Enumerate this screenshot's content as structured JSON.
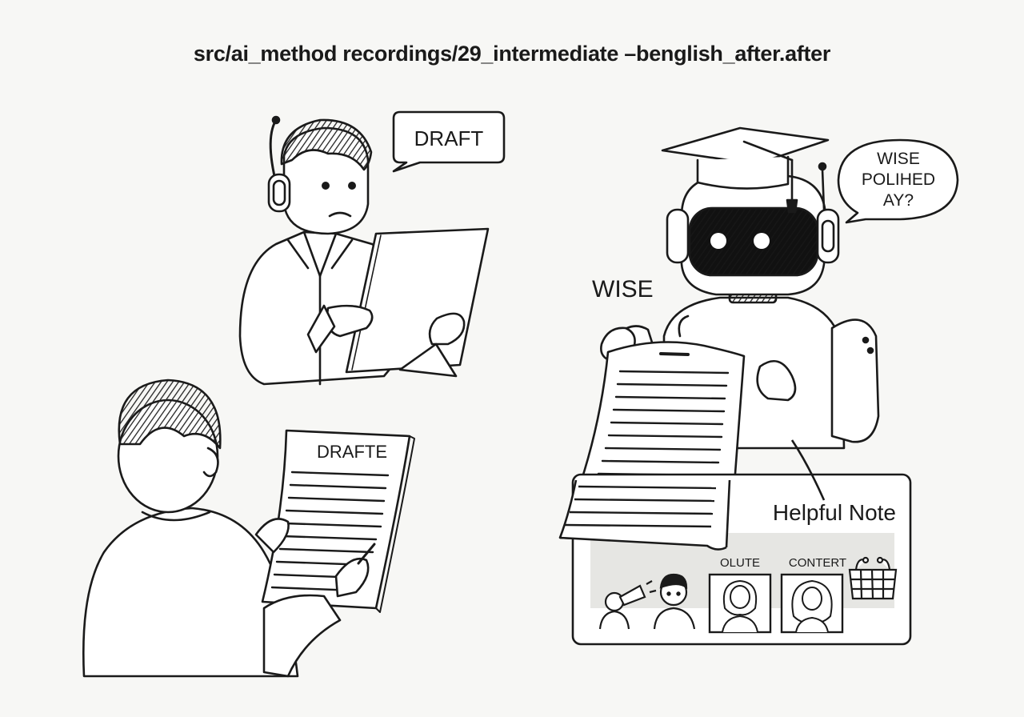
{
  "header": {
    "title": "src/ai_method recordings/29_intermediate  –benglish_after.after"
  },
  "top_person": {
    "speech": "DRAFT"
  },
  "bottom_person": {
    "document_heading": "DRAFTE"
  },
  "robot": {
    "speech_line1": "WISE",
    "speech_line2": "POLIHED",
    "speech_line3": "AY?",
    "caption": "WISE"
  },
  "note_panel": {
    "title": "Helpful Note",
    "thumb_label_1": "OLUTE",
    "thumb_label_2": "CONTERT"
  },
  "icons": [
    "headphones-icon",
    "graduation-cap-icon",
    "calendar-icon"
  ]
}
